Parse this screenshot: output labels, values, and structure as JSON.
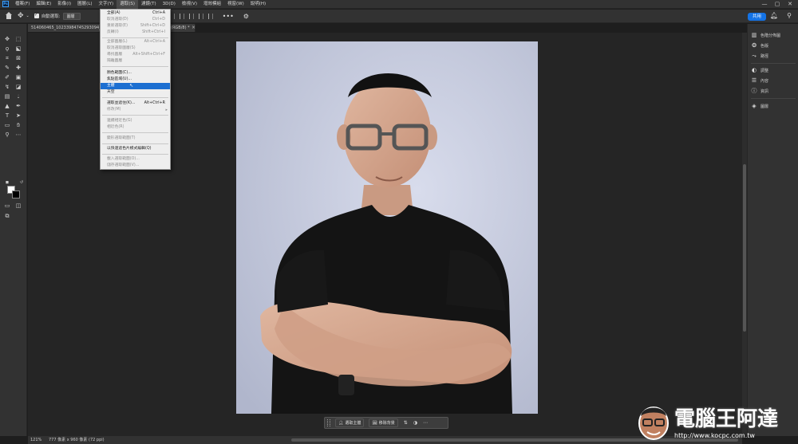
{
  "menubar": {
    "logo": "Ps",
    "items": [
      "檔案(F)",
      "編輯(E)",
      "影像(I)",
      "圖層(L)",
      "文字(Y)",
      "選取(S)",
      "濾鏡(T)",
      "3D(D)",
      "檢視(V)",
      "增效模組",
      "視窗(W)",
      "說明(H)"
    ],
    "active_item": "選取(S)",
    "window_controls": [
      "—",
      "▢",
      "✕"
    ]
  },
  "optionsbar": {
    "auto_select_label": "自動選取:",
    "auto_select_value": "圖層",
    "share_label": "共用"
  },
  "document_tab": {
    "title": "514060465_10233984745293094_7",
    "title_suffix": "(RGB/8) *",
    "close": "×"
  },
  "dropdown": {
    "items": [
      {
        "label": "全部(A)",
        "shortcut": "Ctrl+A",
        "state": "normal"
      },
      {
        "label": "取消選取(D)",
        "shortcut": "Ctrl+D",
        "state": "disabled"
      },
      {
        "label": "重新選取(E)",
        "shortcut": "Shift+Ctrl+D",
        "state": "disabled"
      },
      {
        "label": "反轉(I)",
        "shortcut": "Shift+Ctrl+I",
        "state": "disabled"
      },
      {
        "label": "全部圖層(L)",
        "shortcut": "Alt+Ctrl+A",
        "state": "disabled"
      },
      {
        "label": "取消選取圖層(S)",
        "shortcut": "",
        "state": "disabled"
      },
      {
        "label": "尋找圖層",
        "shortcut": "Alt+Shift+Ctrl+F",
        "state": "disabled"
      },
      {
        "label": "隔離圖層",
        "shortcut": "",
        "state": "disabled"
      },
      {
        "label": "顏色範圍(C)...",
        "shortcut": "",
        "state": "normal"
      },
      {
        "label": "焦點區域(U)...",
        "shortcut": "",
        "state": "normal"
      },
      {
        "label": "主體",
        "shortcut": "",
        "state": "highlight"
      },
      {
        "label": "天空",
        "shortcut": "",
        "state": "normal"
      },
      {
        "label": "選取並遮住(K)...",
        "shortcut": "Alt+Ctrl+R",
        "state": "normal"
      },
      {
        "label": "修改(M)",
        "shortcut": "",
        "state": "disabled",
        "submenu": true
      },
      {
        "label": "連續相近色(G)",
        "shortcut": "",
        "state": "disabled"
      },
      {
        "label": "相近色(R)",
        "shortcut": "",
        "state": "disabled"
      },
      {
        "label": "變形選取範圍(T)",
        "shortcut": "",
        "state": "disabled"
      },
      {
        "label": "以快速遮色片模式編輯(Q)",
        "shortcut": "",
        "state": "normal"
      },
      {
        "label": "載入選取範圍(O)...",
        "shortcut": "",
        "state": "disabled"
      },
      {
        "label": "儲存選取範圍(V)...",
        "shortcut": "",
        "state": "disabled"
      }
    ]
  },
  "rightpanel": {
    "items": [
      "色階分佈圖",
      "色版",
      "路徑",
      "調整",
      "內容",
      "資訊",
      "圖層"
    ]
  },
  "statusbar": {
    "zoom": "121%",
    "doc_info": "777 像素 x 960 像素 (72 ppi)"
  },
  "taskbar": {
    "select_subject": "選取主體",
    "remove_background": "移除背景"
  },
  "watermark": {
    "text": "電腦王阿達",
    "url": "http://www.kocpc.com.tw"
  },
  "colors": {
    "accent": "#1473e6",
    "highlight": "#1c6fd1",
    "background": "#1e1e1e",
    "panel": "#323232"
  },
  "icons": [
    "home-icon",
    "move-icon",
    "gear-icon",
    "bell-icon",
    "search-icon"
  ]
}
